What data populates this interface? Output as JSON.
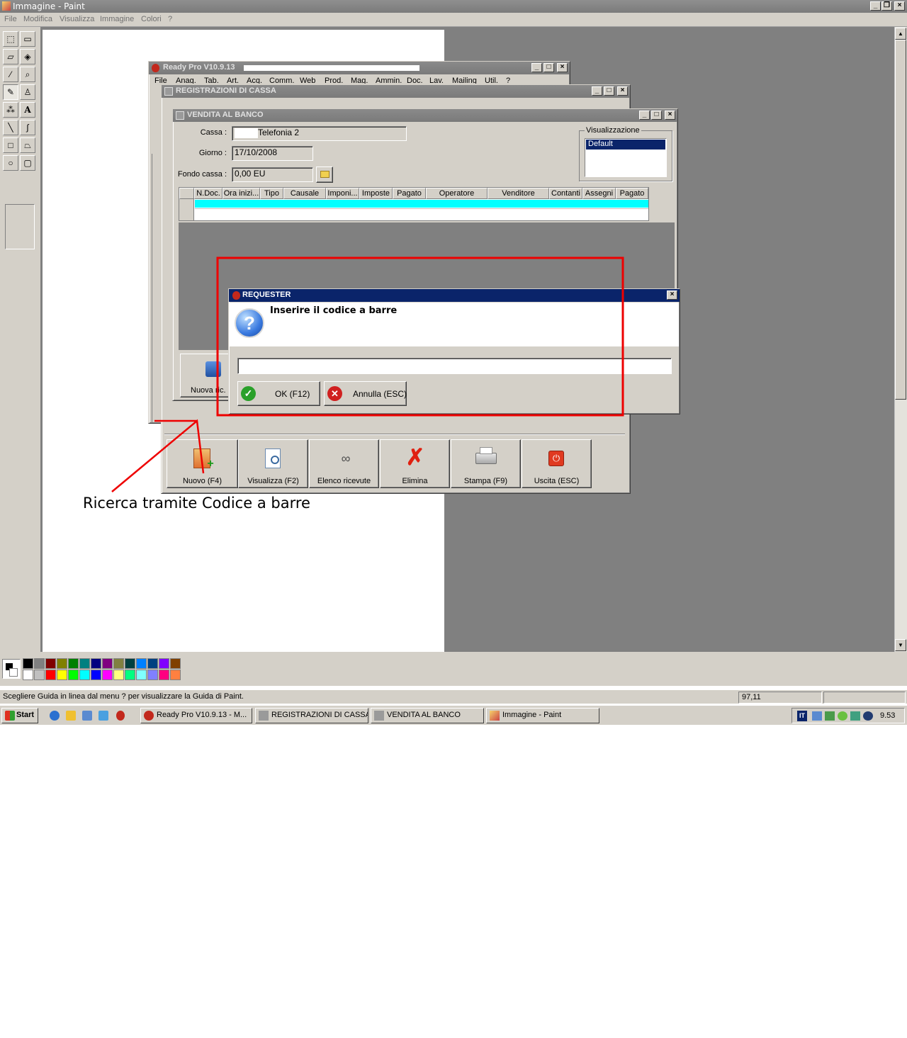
{
  "paint": {
    "title": "Immagine - Paint",
    "menu": [
      "File",
      "Modifica",
      "Visualizza",
      "Immagine",
      "Colori",
      "?"
    ],
    "status_text": "Scegliere Guida in linea dal menu ? per visualizzare la Guida di Paint.",
    "coords": "97,11",
    "annotation": "Ricerca tramite Codice a barre"
  },
  "palette_colors": [
    "#000000",
    "#808080",
    "#800000",
    "#808000",
    "#008000",
    "#008080",
    "#000080",
    "#800080",
    "#808040",
    "#004040",
    "#0080ff",
    "#004080",
    "#8000ff",
    "#804000",
    "#ffffff",
    "#c0c0c0",
    "#ff0000",
    "#ffff00",
    "#00ff00",
    "#00ffff",
    "#0000ff",
    "#ff00ff",
    "#ffff80",
    "#00ff80",
    "#80ffff",
    "#8080ff",
    "#ff0080",
    "#ff8040"
  ],
  "readypro": {
    "title": "Ready Pro V10.9.13",
    "menu": [
      "File",
      "Anag.",
      "Tab.",
      "Art.",
      "Acq.",
      "Comm.",
      "Web",
      "Prod.",
      "Mag.",
      "Ammin.",
      "Doc.",
      "Lav.",
      "Mailing",
      "Util.",
      "?"
    ]
  },
  "registrazioni": {
    "title": "REGISTRAZIONI DI CASSA",
    "buttons": {
      "nuovo": "Nuovo (F4)",
      "visualizza": "Visualizza (F2)",
      "elenco": "Elenco ricevute",
      "elimina": "Elimina",
      "stampa": "Stampa (F9)",
      "uscita": "Uscita (ESC)"
    }
  },
  "vendita": {
    "title": "VENDITA AL BANCO",
    "cassa_label": "Cassa :",
    "cassa_value": "Telefonia 2",
    "giorno_label": "Giorno :",
    "giorno_value": "17/10/2008",
    "fondo_label": "Fondo cassa :",
    "fondo_value": "0,00 EU",
    "visualizzazione_label": "Visualizzazione",
    "visualizzazione_selected": "Default",
    "columns": [
      "N.Doc.",
      "Ora inizi...",
      "Tipo",
      "Causale",
      "Imponi...",
      "Imposte",
      "Pagato",
      "Operatore",
      "Venditore",
      "Contanti",
      "Assegni",
      "Pagato"
    ],
    "nuova_btn": "Nuova ric."
  },
  "requester": {
    "title": "REQUESTER",
    "prompt": "Inserire il codice a barre",
    "input_value": "",
    "ok": "OK (F12)",
    "cancel": "Annulla (ESC)"
  },
  "taskbar": {
    "start": "Start",
    "tasks": [
      "Ready Pro V10.9.13 - M...",
      "REGISTRAZIONI DI CASSA",
      "VENDITA AL BANCO",
      "Immagine - Paint"
    ],
    "lang": "IT",
    "clock": "9.53"
  }
}
